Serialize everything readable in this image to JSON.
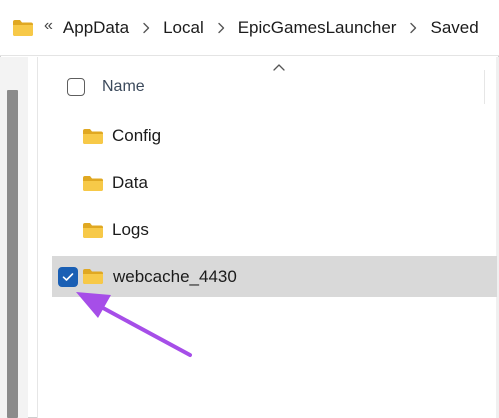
{
  "address_bar": {
    "folder_icon": "folder-icon",
    "overflow": "«",
    "crumbs": [
      "AppData",
      "Local",
      "EpicGamesLauncher",
      "Saved"
    ],
    "separator_icon": "chevron-right-icon"
  },
  "list": {
    "sort_indicator": "chevron-up-icon",
    "header": {
      "name_label": "Name"
    },
    "items": [
      {
        "name": "Config",
        "selected": false
      },
      {
        "name": "Data",
        "selected": false
      },
      {
        "name": "Logs",
        "selected": false
      },
      {
        "name": "webcache_4430",
        "selected": true
      }
    ]
  },
  "annotation": {
    "arrow_color": "#a64ee8",
    "icon": "annotation-arrow"
  },
  "colors": {
    "folder": "#f7c948",
    "selection": "#d9d9d9",
    "checkbox_checked": "#1a5fb4"
  }
}
